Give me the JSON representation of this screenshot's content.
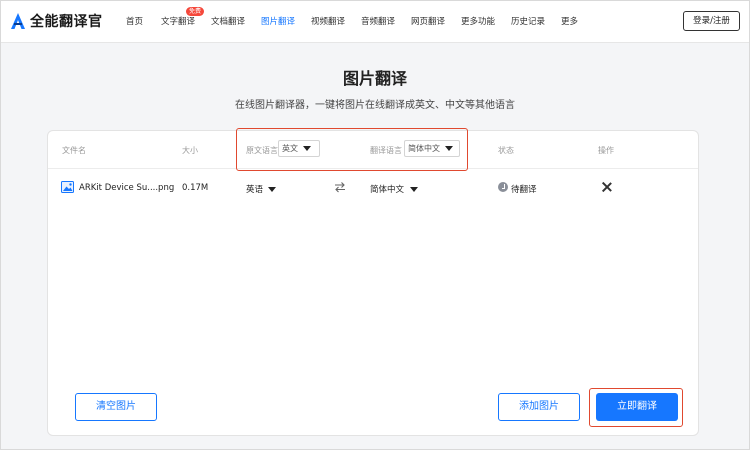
{
  "header": {
    "logo_text": "全能翻译官",
    "nav": [
      {
        "label": "首页"
      },
      {
        "label": "文字翻译",
        "badge": "免费"
      },
      {
        "label": "文档翻译"
      },
      {
        "label": "图片翻译",
        "active": true
      },
      {
        "label": "视频翻译"
      },
      {
        "label": "音频翻译"
      },
      {
        "label": "网页翻译"
      },
      {
        "label": "更多功能"
      },
      {
        "label": "历史记录"
      },
      {
        "label": "更多"
      }
    ],
    "login_label": "登录/注册"
  },
  "page": {
    "title": "图片翻译",
    "subtitle": "在线图片翻译器，一键将图片在线翻译成英文、中文等其他语言"
  },
  "table": {
    "columns": {
      "filename": "文件名",
      "size": "大小",
      "source_lang": "原文语言",
      "target_lang": "翻译语言",
      "status": "状态",
      "action": "操作"
    },
    "header_source_value": "英文",
    "header_target_value": "简体中文",
    "rows": [
      {
        "filename": "ARKit Device Su....png",
        "size": "0.17M",
        "source": "英语",
        "target": "简体中文",
        "status": "待翻译"
      }
    ]
  },
  "buttons": {
    "clear": "清空图片",
    "add": "添加图片",
    "translate": "立即翻译"
  },
  "colors": {
    "accent": "#1677ff",
    "highlight": "#e0492f",
    "badge": "#f5483b"
  }
}
